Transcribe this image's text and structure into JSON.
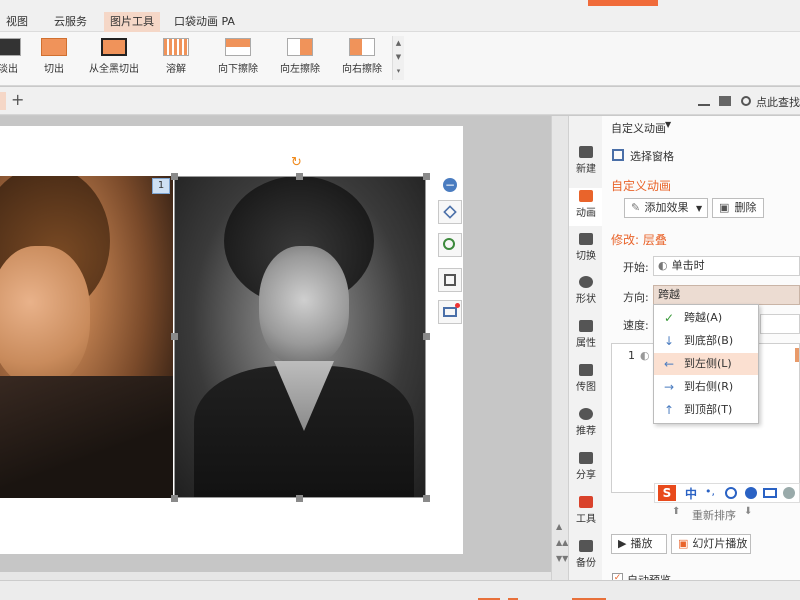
{
  "menubar": {
    "items": [
      "视图",
      "云服务",
      "图片工具",
      "口袋动画 PA"
    ],
    "active_index": 2,
    "accent_color": "#f06b3a"
  },
  "ribbon": {
    "buttons": [
      "淡出",
      "切出",
      "从全黑切出",
      "溶解",
      "向下擦除",
      "向左擦除",
      "向右擦除"
    ]
  },
  "tabrow": {
    "plus": "+",
    "search_label": "点此查找"
  },
  "slide": {
    "badge": "1",
    "rotate_icon": "↻"
  },
  "sidestrip": {
    "items": [
      "新建",
      "动画",
      "切换",
      "形状",
      "属性",
      "传图",
      "推荐",
      "分享",
      "工具",
      "备份"
    ],
    "active_index": 1
  },
  "pane": {
    "title": "自定义动画",
    "select_pane": "选择窗格",
    "section_title": "自定义动画",
    "add_effect": "添加效果",
    "delete": "删除",
    "modify_label": "修改: 层叠",
    "start_label": "开始:",
    "start_value": "单击时",
    "direction_label": "方向:",
    "direction_value": "跨越",
    "speed_label": "速度:",
    "list_index": "1",
    "reorder": "重新排序",
    "play": "播放",
    "slideshow": "幻灯片播放",
    "autopreview": "自动预览"
  },
  "dropdown": {
    "items": [
      {
        "label": "跨越(A)",
        "glyph": "✓"
      },
      {
        "label": "到底部(B)",
        "glyph": "↓"
      },
      {
        "label": "到左侧(L)",
        "glyph": "←"
      },
      {
        "label": "到右侧(R)",
        "glyph": "→"
      },
      {
        "label": "到顶部(T)",
        "glyph": "↑"
      }
    ],
    "highlight_index": 2
  },
  "ime": {
    "logo": "S",
    "mode": "中"
  }
}
